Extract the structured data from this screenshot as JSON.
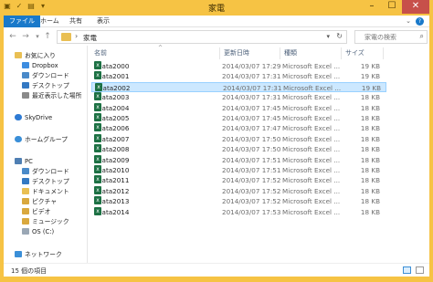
{
  "window": {
    "title": "家電",
    "controls": {
      "minimize": "–",
      "maximize": "☐",
      "close": "✕"
    }
  },
  "ribbon": {
    "tabs": [
      "ファイル",
      "ホーム",
      "共有",
      "表示"
    ],
    "help": "?"
  },
  "address": {
    "path": "家電",
    "search_placeholder": "家電の検索"
  },
  "nav": {
    "favorites": "お気に入り",
    "items": [
      "Dropbox",
      "ダウンロード",
      "デスクトップ",
      "最近表示した場所"
    ],
    "skydrive": "SkyDrive",
    "homegroup": "ホームグループ",
    "pc": "PC",
    "pc_items": [
      "ダウンロード",
      "デスクトップ",
      "ドキュメント",
      "ピクチャ",
      "ビデオ",
      "ミュージック",
      "OS (C:)"
    ],
    "network": "ネットワーク"
  },
  "columns": {
    "name": "名前",
    "date": "更新日時",
    "type": "種類",
    "size": "サイズ"
  },
  "files": [
    {
      "name": "Data2000",
      "date": "2014/03/07 17:29",
      "type": "Microsoft Excel ...",
      "size": "19 KB"
    },
    {
      "name": "Data2001",
      "date": "2014/03/07 17:31",
      "type": "Microsoft Excel ...",
      "size": "19 KB"
    },
    {
      "name": "Data2002",
      "date": "2014/03/07 17:31",
      "type": "Microsoft Excel ...",
      "size": "19 KB"
    },
    {
      "name": "Data2003",
      "date": "2014/03/07 17:31",
      "type": "Microsoft Excel ...",
      "size": "18 KB"
    },
    {
      "name": "Data2004",
      "date": "2014/03/07 17:45",
      "type": "Microsoft Excel ...",
      "size": "18 KB"
    },
    {
      "name": "Data2005",
      "date": "2014/03/07 17:45",
      "type": "Microsoft Excel ...",
      "size": "18 KB"
    },
    {
      "name": "Data2006",
      "date": "2014/03/07 17:47",
      "type": "Microsoft Excel ...",
      "size": "18 KB"
    },
    {
      "name": "Data2007",
      "date": "2014/03/07 17:50",
      "type": "Microsoft Excel ...",
      "size": "18 KB"
    },
    {
      "name": "Data2008",
      "date": "2014/03/07 17:50",
      "type": "Microsoft Excel ...",
      "size": "18 KB"
    },
    {
      "name": "Data2009",
      "date": "2014/03/07 17:51",
      "type": "Microsoft Excel ...",
      "size": "18 KB"
    },
    {
      "name": "Data2010",
      "date": "2014/03/07 17:51",
      "type": "Microsoft Excel ...",
      "size": "18 KB"
    },
    {
      "name": "Data2011",
      "date": "2014/03/07 17:52",
      "type": "Microsoft Excel ...",
      "size": "18 KB"
    },
    {
      "name": "Data2012",
      "date": "2014/03/07 17:52",
      "type": "Microsoft Excel ...",
      "size": "18 KB"
    },
    {
      "name": "Data2013",
      "date": "2014/03/07 17:52",
      "type": "Microsoft Excel ...",
      "size": "18 KB"
    },
    {
      "name": "Data2014",
      "date": "2014/03/07 17:53",
      "type": "Microsoft Excel ...",
      "size": "18 KB"
    }
  ],
  "selected_file": "Data2002",
  "status": {
    "count": "15 個の項目"
  },
  "colors": {
    "titlebar": "#f6c344",
    "file_tab": "#1979ca",
    "selection": "#cce8ff",
    "excel_icon": "#1d7144"
  }
}
